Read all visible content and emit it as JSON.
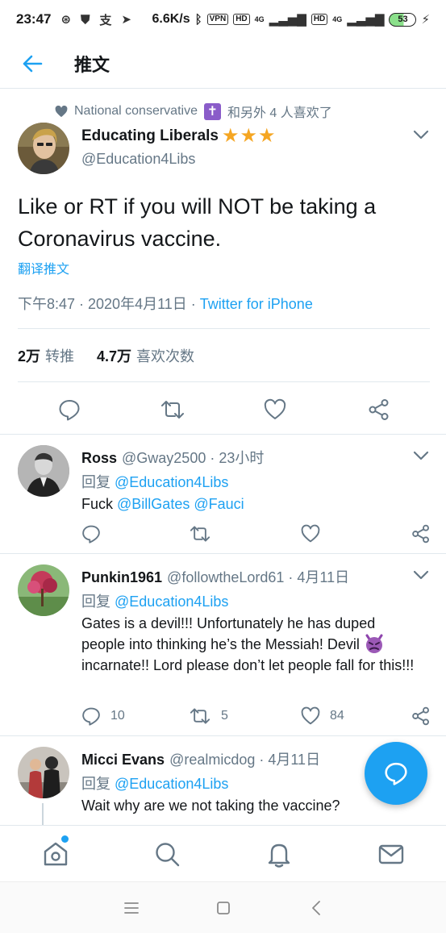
{
  "status_bar": {
    "time": "23:47",
    "left_icons": [
      "weibo-icon",
      "shield-icon",
      "alipay-icon",
      "location-arrow-icon"
    ],
    "speed": "6.6K/s",
    "vpn": "VPN",
    "hd1": "HD",
    "net1": "4G",
    "hd2": "HD",
    "net2": "4G",
    "battery": "53"
  },
  "app_bar": {
    "title": "推文"
  },
  "main_tweet": {
    "social_context": "National conservative",
    "social_context_suffix": "和另外 4 人喜欢了",
    "badge": "✝",
    "author_name": "Educating Liberals",
    "author_emoji": "★★★",
    "author_handle": "@Education4Libs",
    "text": "Like or RT if you will NOT be taking a Coronavirus vaccine.",
    "translate_label": "翻译推文",
    "timestamp": "下午8:47 · 2020年4月11日 · ",
    "source": "Twitter for iPhone",
    "retweets_count": "2万",
    "retweets_label": "转推",
    "likes_count": "4.7万",
    "likes_label": "喜欢次数"
  },
  "replies": [
    {
      "name": "Ross",
      "handle": "@Gway2500",
      "time": " · 23小时",
      "reply_prefix": "回复",
      "reply_to": "@Education4Libs",
      "body_prefix": "Fuck",
      "mention1": "@BillGates",
      "mention2": "@Fauci",
      "reply_count": "",
      "retweet_count": "",
      "like_count": ""
    },
    {
      "name": "Punkin1961",
      "handle": "@followtheLord61",
      "time": " · 4月11日",
      "reply_prefix": "回复",
      "reply_to": "@Education4Libs",
      "body_part1": "Gates is a devil!!!  Unfortunately he has duped people into thinking he’s the Messiah!  Devil",
      "body_part2": "incarnate!!  Lord please don’t let people fall for this!!!",
      "reply_count": "10",
      "retweet_count": "5",
      "like_count": "84"
    },
    {
      "name": "Micci Evans",
      "handle": "@realmicdog",
      "time": " · 4月11日",
      "reply_prefix": "回复",
      "reply_to": "@Education4Libs",
      "body": "Wait why are we not taking the vaccine?"
    }
  ],
  "colors": {
    "accent": "#1da1f2",
    "secondary_text": "#657786",
    "primary_text": "#14171a",
    "divider": "#e1e8ed",
    "star": "#f5a623"
  }
}
